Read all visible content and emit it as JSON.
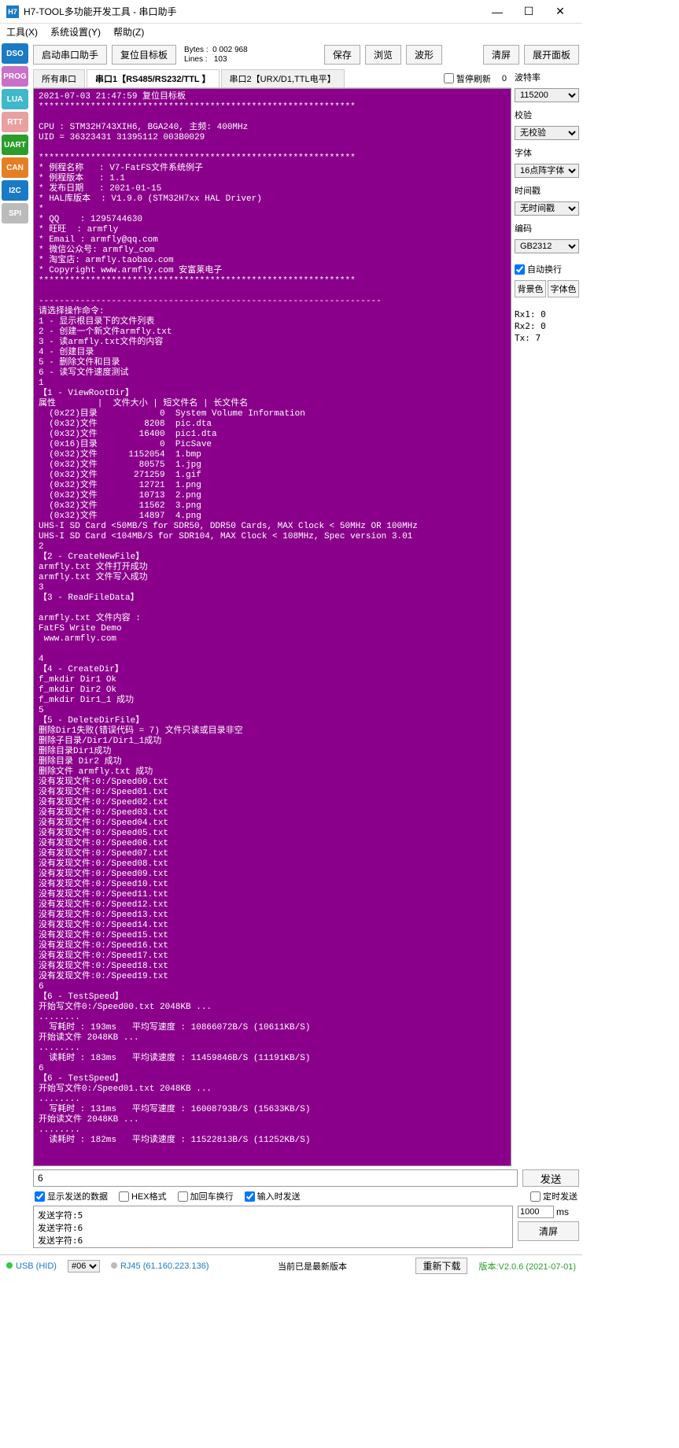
{
  "title": "H7-TOOL多功能开发工具 - 串口助手",
  "menu": {
    "tool": "工具(X)",
    "sys": "系统设置(Y)",
    "help": "帮助(Z)"
  },
  "sidebar": [
    {
      "label": "DSO",
      "bg": "#1a7bc4"
    },
    {
      "label": "PROG",
      "bg": "#c970c9"
    },
    {
      "label": "LUA",
      "bg": "#3fb8c9"
    },
    {
      "label": "RTT",
      "bg": "#e9a0a0"
    },
    {
      "label": "UART",
      "bg": "#2a9d2a"
    },
    {
      "label": "CAN",
      "bg": "#e67e22"
    },
    {
      "label": "I2C",
      "bg": "#1a7bc4"
    },
    {
      "label": "SPI",
      "bg": "#bbb"
    }
  ],
  "toolbar": {
    "start": "启动串口助手",
    "reset": "复位目标板",
    "bytesLabel": "Bytes :",
    "bytes": "0 002 968",
    "linesLabel": "Lines :",
    "lines": "103",
    "save": "保存",
    "browse": "浏览",
    "wave": "波形",
    "clear": "清屏",
    "expand": "展开面板"
  },
  "tabs": {
    "all": "所有串口",
    "p1": "串口1【RS485/RS232/TTL 】",
    "p2": "串口2【URX/D1,TTL电平】",
    "pause": "暂停刷新",
    "zero": "0"
  },
  "right": {
    "baudLabel": "波特率",
    "baud": "115200",
    "parityLabel": "校验",
    "parity": "无校验",
    "fontLabel": "字体",
    "font": "16点阵字体",
    "tsLabel": "时间戳",
    "ts": "无时间戳",
    "encLabel": "编码",
    "enc": "GB2312",
    "wrap": "自动换行",
    "bg": "背景色",
    "fg": "字体色",
    "rx1": "Rx1:  0",
    "rx2": "Rx2:  0",
    "tx": "Tx:   7"
  },
  "console": "2021-07-03 21:47:59 复位目标板\n*************************************************************\n\nCPU : STM32H743XIH6, BGA240, 主频: 400MHz\nUID = 36323431 31395112 003B0029\n\n*************************************************************\n* 例程名称   : V7-FatFS文件系统例子\n* 例程版本   : 1.1\n* 发布日期   : 2021-01-15\n* HAL库版本  : V1.9.0 (STM32H7xx HAL Driver)\n* \n* QQ    : 1295744630\n* 旺旺  : armfly\n* Email : armfly@qq.com\n* 微信公众号: armfly_com\n* 淘宝店: armfly.taobao.com\n* Copyright www.armfly.com 安富莱电子\n*************************************************************\n\n------------------------------------------------------------------\n请选择操作命令:\n1 - 显示根目录下的文件列表\n2 - 创建一个新文件armfly.txt\n3 - 读armfly.txt文件的内容\n4 - 创建目录\n5 - 删除文件和目录\n6 - 读写文件速度测试\n1\n【1 - ViewRootDir】\n属性        |  文件大小 | 短文件名 | 长文件名\n  (0x22)目录            0  System Volume Information\n  (0x32)文件         8208  pic.dta\n  (0x32)文件        16400  pic1.dta\n  (0x16)目录            0  PicSave\n  (0x32)文件      1152054  1.bmp\n  (0x32)文件        80575  1.jpg\n  (0x32)文件       271259  1.gif\n  (0x32)文件        12721  1.png\n  (0x32)文件        10713  2.png\n  (0x32)文件        11562  3.png\n  (0x32)文件        14897  4.png\nUHS-I SD Card <50MB/S for SDR50, DDR50 Cards, MAX Clock < 50MHz OR 100MHz\nUHS-I SD Card <104MB/S for SDR104, MAX Clock < 108MHz, Spec version 3.01\n2\n【2 - CreateNewFile】\narmfly.txt 文件打开成功\narmfly.txt 文件写入成功\n3\n【3 - ReadFileData】\n\narmfly.txt 文件内容 : \nFatFS Write Demo \n www.armfly.com \n\n4\n【4 - CreateDir】\nf_mkdir Dir1 Ok\nf_mkdir Dir2 Ok\nf_mkdir Dir1_1 成功\n5\n【5 - DeleteDirFile】\n删除Dir1失败(错误代码 = 7) 文件只读或目录非空\n删除子目录/Dir1/Dir1_1成功\n删除目录Dir1成功\n删除目录 Dir2 成功\n删除文件 armfly.txt 成功\n没有发现文件:0:/Speed00.txt\n没有发现文件:0:/Speed01.txt\n没有发现文件:0:/Speed02.txt\n没有发现文件:0:/Speed03.txt\n没有发现文件:0:/Speed04.txt\n没有发现文件:0:/Speed05.txt\n没有发现文件:0:/Speed06.txt\n没有发现文件:0:/Speed07.txt\n没有发现文件:0:/Speed08.txt\n没有发现文件:0:/Speed09.txt\n没有发现文件:0:/Speed10.txt\n没有发现文件:0:/Speed11.txt\n没有发现文件:0:/Speed12.txt\n没有发现文件:0:/Speed13.txt\n没有发现文件:0:/Speed14.txt\n没有发现文件:0:/Speed15.txt\n没有发现文件:0:/Speed16.txt\n没有发现文件:0:/Speed17.txt\n没有发现文件:0:/Speed18.txt\n没有发现文件:0:/Speed19.txt\n6\n【6 - TestSpeed】\n开始写文件0:/Speed00.txt 2048KB ...\n........\n  写耗时 : 193ms   平均写速度 : 10866072B/S (10611KB/S)\n开始读文件 2048KB ...\n........\n  读耗时 : 183ms   平均读速度 : 11459846B/S (11191KB/S)\n6\n【6 - TestSpeed】\n开始写文件0:/Speed01.txt 2048KB ...\n........\n  写耗时 : 131ms   平均写速度 : 16008793B/S (15633KB/S)\n开始读文件 2048KB ...\n........\n  读耗时 : 182ms   平均读速度 : 11522813B/S (11252KB/S)",
  "send": {
    "input": "6",
    "btn": "发送",
    "showSent": "显示发送的数据",
    "hex": "HEX格式",
    "crlf": "加回车换行",
    "sendOnInput": "输入时发送",
    "timed": "定时发送",
    "ms": "1000",
    "msUnit": "ms",
    "clear": "清屏",
    "log": "发送字符:5\n发送字符:6\n发送字符:6"
  },
  "status": {
    "usb": "USB (HID)",
    "ver06": "#06",
    "rj45": "RJ45 (61.160.223.136)",
    "latest": "当前已是最新版本",
    "redl": "重新下载",
    "version": "版本:V2.0.6 (2021-07-01)"
  }
}
